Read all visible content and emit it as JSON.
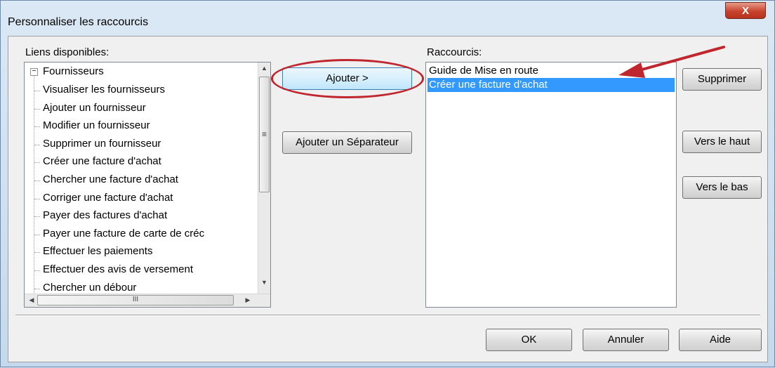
{
  "window": {
    "title": "Personnaliser les raccourcis",
    "close_label": "X"
  },
  "available": {
    "label": "Liens disponibles:",
    "root": "Fournisseurs",
    "items": [
      "Visualiser les fournisseurs",
      "Ajouter un fournisseur",
      "Modifier un fournisseur",
      "Supprimer un fournisseur",
      "Créer une  facture d'achat",
      "Chercher une facture d'achat",
      "Corriger une facture d'achat",
      "Payer des factures d'achat",
      "Payer une facture de carte de créc",
      "Effectuer les paiements",
      "Effectuer des avis de versement",
      "Chercher un débour"
    ]
  },
  "middle": {
    "add_label": "Ajouter >",
    "add_separator_label": "Ajouter un Séparateur"
  },
  "shortcuts": {
    "label": "Raccourcis:",
    "items": [
      "Guide de Mise en route",
      "Créer une  facture d'achat"
    ],
    "selected_index": 1
  },
  "right": {
    "delete_label": "Supprimer",
    "up_label": "Vers le haut",
    "down_label": "Vers le bas"
  },
  "footer": {
    "ok_label": "OK",
    "cancel_label": "Annuler",
    "help_label": "Aide"
  },
  "scroll": {
    "hscroll_grip": "III",
    "vscroll_grip": "≡"
  },
  "colors": {
    "annotation": "#c0262d",
    "selection": "#3399ff"
  }
}
